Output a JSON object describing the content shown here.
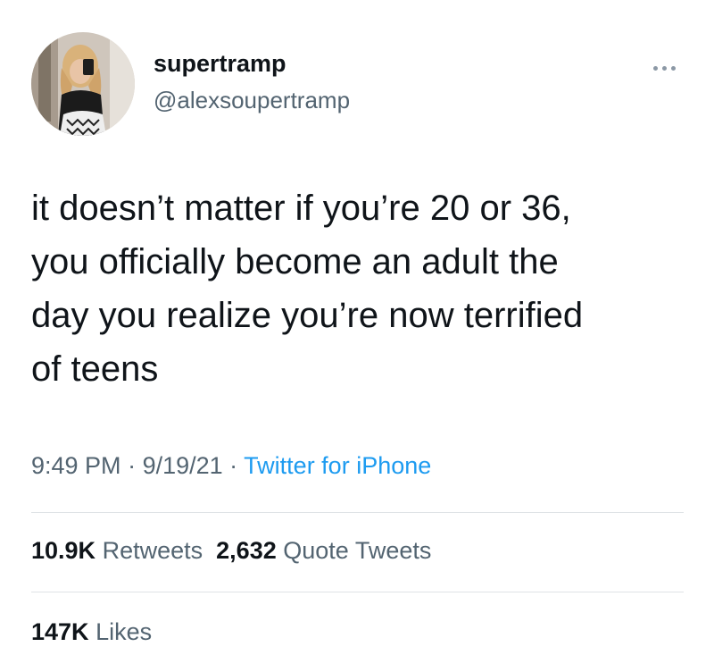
{
  "author": {
    "display_name": "supertramp",
    "handle": "@alexsoupertramp",
    "avatar_icon": "profile-photo"
  },
  "more_icon": "more-horizontal-icon",
  "tweet": {
    "lines": [
      "it doesn’t matter if you’re 20 or 36,",
      "you officially become an adult the",
      "day you realize you’re now terrified",
      "of teens"
    ]
  },
  "meta": {
    "time": "9:49 PM",
    "sep1": " · ",
    "date": "9/19/21",
    "sep2": " · ",
    "source": "Twitter for iPhone"
  },
  "stats": {
    "retweets_count": "10.9K",
    "retweets_label": "Retweets",
    "quotes_count": "2,632",
    "quotes_label": "Quote Tweets",
    "likes_count": "147K",
    "likes_label": "Likes"
  },
  "colors": {
    "text": "#0f1419",
    "secondary": "#536471",
    "link": "#1d9bf0",
    "divider": "#dfe3e6"
  }
}
